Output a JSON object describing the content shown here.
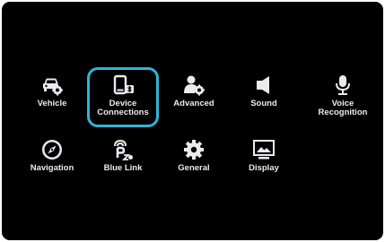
{
  "colors": {
    "background": "#000000",
    "icon": "#e9ebee",
    "text": "#e9ebee",
    "selection": "#2fb4d8"
  },
  "selected_item": "Device Connections",
  "menu": {
    "row1": [
      {
        "label": "Vehicle",
        "icon": "car-gear-icon"
      },
      {
        "label": "Device\nConnections",
        "icon": "phone-bluetooth-icon"
      },
      {
        "label": "Advanced",
        "icon": "person-gear-icon"
      },
      {
        "label": "Sound",
        "icon": "speaker-icon"
      },
      {
        "label": "Voice\nRecognition",
        "icon": "microphone-icon"
      }
    ],
    "row2": [
      {
        "label": "Navigation",
        "icon": "compass-icon"
      },
      {
        "label": "Blue Link",
        "icon": "blue-link-icon"
      },
      {
        "label": "General",
        "icon": "gear-icon"
      },
      {
        "label": "Display",
        "icon": "display-image-icon"
      }
    ]
  }
}
